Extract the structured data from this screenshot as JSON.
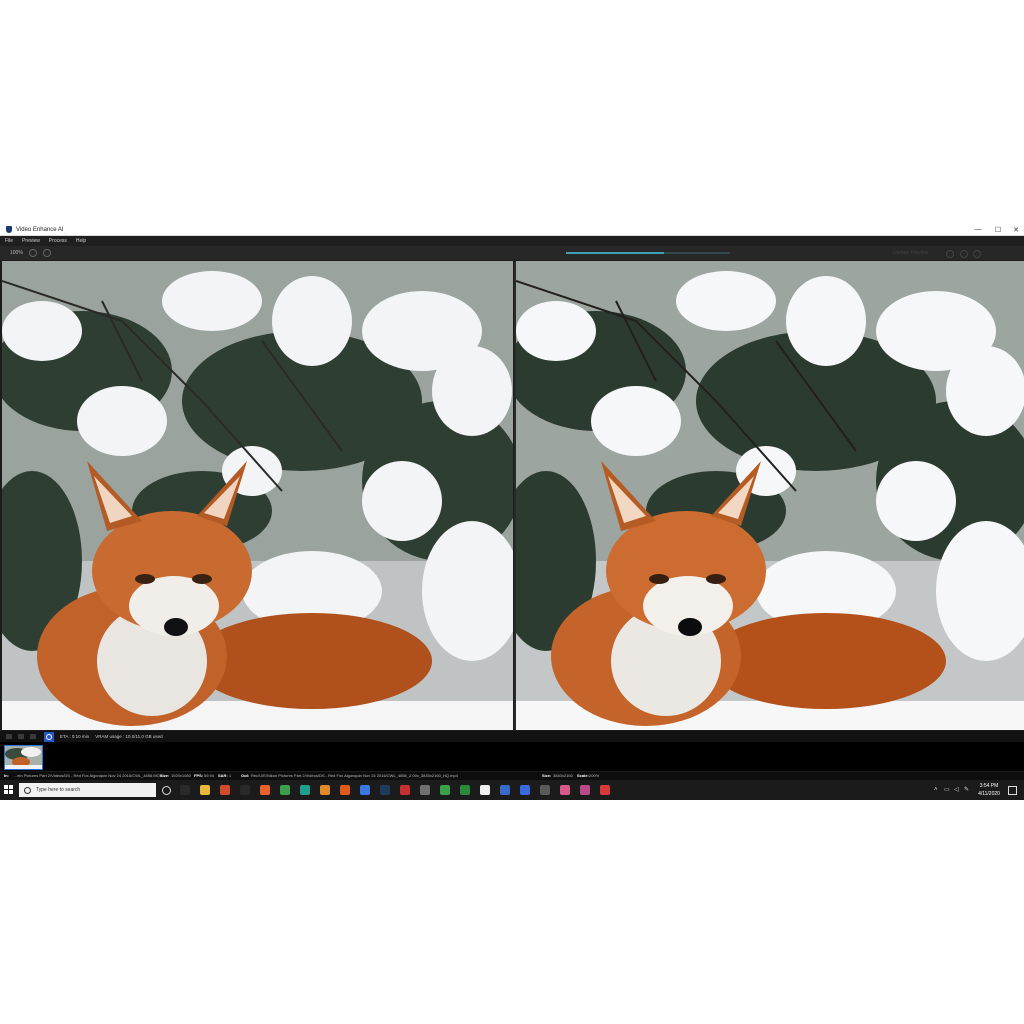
{
  "window": {
    "title": "Video Enhance AI",
    "controls": {
      "minimize": "—",
      "maximize": "☐",
      "close": "✕"
    }
  },
  "menu": [
    {
      "label": "File"
    },
    {
      "label": "Preview"
    },
    {
      "label": "Process"
    },
    {
      "label": "Help"
    }
  ],
  "toolbar": {
    "zoom": "100%",
    "progress": 0.6,
    "right_text": "Update Preview",
    "accent_color": "#3fa0b4"
  },
  "status": {
    "eta": "ETA : 0:10 min",
    "vram": "VRAM usage : 10.0/11.0 GB used"
  },
  "info": {
    "in_label": "In:",
    "in_path": "...ein Pictures Part 2/Videos/DS - Red Fox Algonquin Nov 24 2016/CWL_4856.MOV",
    "in_size_label": "Size:",
    "in_size": "1920x1080",
    "fps_label": "FPS:",
    "fps": "59.94",
    "sar_label": "SAR:",
    "sar": "1",
    "out_label": "Out:",
    "out_path": "Rec/U/E/Nikon Pictures Part 2/Videos/DS - Red Fox Algonquin Nov 24 2016/CWL_4856_2.00x_3840x2160_HQ.mp4",
    "out_size_label": "Size:",
    "out_size": "3840x2160",
    "scale_label": "Scale:",
    "scale": "200%"
  },
  "taskbar": {
    "search_placeholder": "Type here to search",
    "time": "3:54 PM",
    "date": "4/11/2020",
    "apps": [
      {
        "name": "task-view-icon",
        "color": "#2a2a2a"
      },
      {
        "name": "file-explorer-icon",
        "color": "#e8b83a"
      },
      {
        "name": "adobe-app-icon",
        "color": "#d14b2a"
      },
      {
        "name": "pen-tool-icon",
        "color": "#2a2a2a"
      },
      {
        "name": "firefox-icon",
        "color": "#e8612c"
      },
      {
        "name": "chrome-icon",
        "color": "#3c9d4a"
      },
      {
        "name": "teal-app-icon",
        "color": "#1fa08a"
      },
      {
        "name": "orange-app-icon",
        "color": "#e08a2a"
      },
      {
        "name": "orange-circle-icon",
        "color": "#e05a1a"
      },
      {
        "name": "blue-circle-icon",
        "color": "#3a7ae0"
      },
      {
        "name": "photoshop-icon",
        "color": "#1e3a5c"
      },
      {
        "name": "red-app-icon",
        "color": "#c83030"
      },
      {
        "name": "grey-app-icon",
        "color": "#707070"
      },
      {
        "name": "green-sync-icon",
        "color": "#3aa04a"
      },
      {
        "name": "green-shield-icon",
        "color": "#2a8a3a"
      },
      {
        "name": "document-icon",
        "color": "#f0f0f0"
      },
      {
        "name": "video-enhance-ai-icon",
        "color": "#3a6ac8"
      },
      {
        "name": "blue-shield-icon",
        "color": "#3a6ae0"
      },
      {
        "name": "gear-app-icon",
        "color": "#5a5a5a"
      },
      {
        "name": "photo-app-icon",
        "color": "#d85a8a"
      },
      {
        "name": "video-player-icon",
        "color": "#b84a8a"
      },
      {
        "name": "red-circle-app-icon",
        "color": "#d83a3a"
      }
    ]
  }
}
